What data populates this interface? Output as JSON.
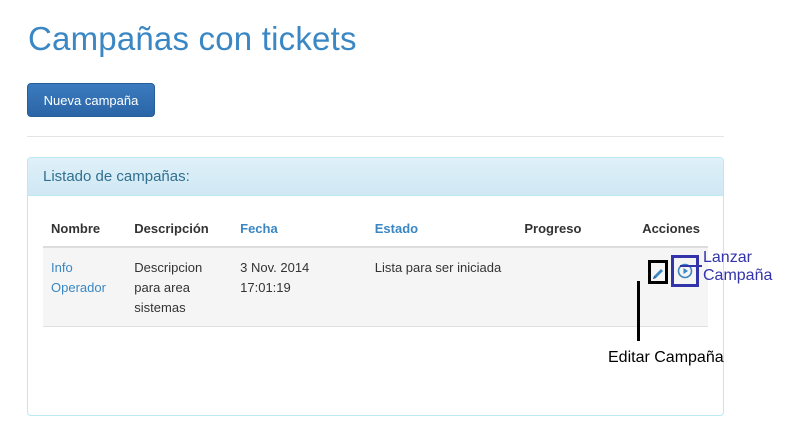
{
  "header": {
    "title": "Campañas con tickets"
  },
  "toolbar": {
    "new_button_label": "Nueva campaña"
  },
  "panel": {
    "heading": "Listado de campañas:",
    "columns": [
      "Nombre",
      "Descripción",
      "Fecha",
      "Estado",
      "Progreso",
      "Acciones"
    ],
    "rows": [
      {
        "name": "Info Operador",
        "description": "Descripcion para area sistemas",
        "date": "3 Nov. 2014 17:01:19",
        "status": "Lista para ser iniciada",
        "progress": ""
      }
    ]
  },
  "annotations": {
    "launch": "Lanzar Campaña",
    "launch_line1": "Lanzar",
    "launch_line2": "Campaña",
    "edit": "Editar Campaña"
  },
  "icons": {
    "edit": "pencil-icon",
    "launch": "play-circle-icon"
  },
  "colors": {
    "accent": "#3a87c4",
    "launch_annotation": "#3333aa",
    "edit_annotation": "#000000"
  }
}
